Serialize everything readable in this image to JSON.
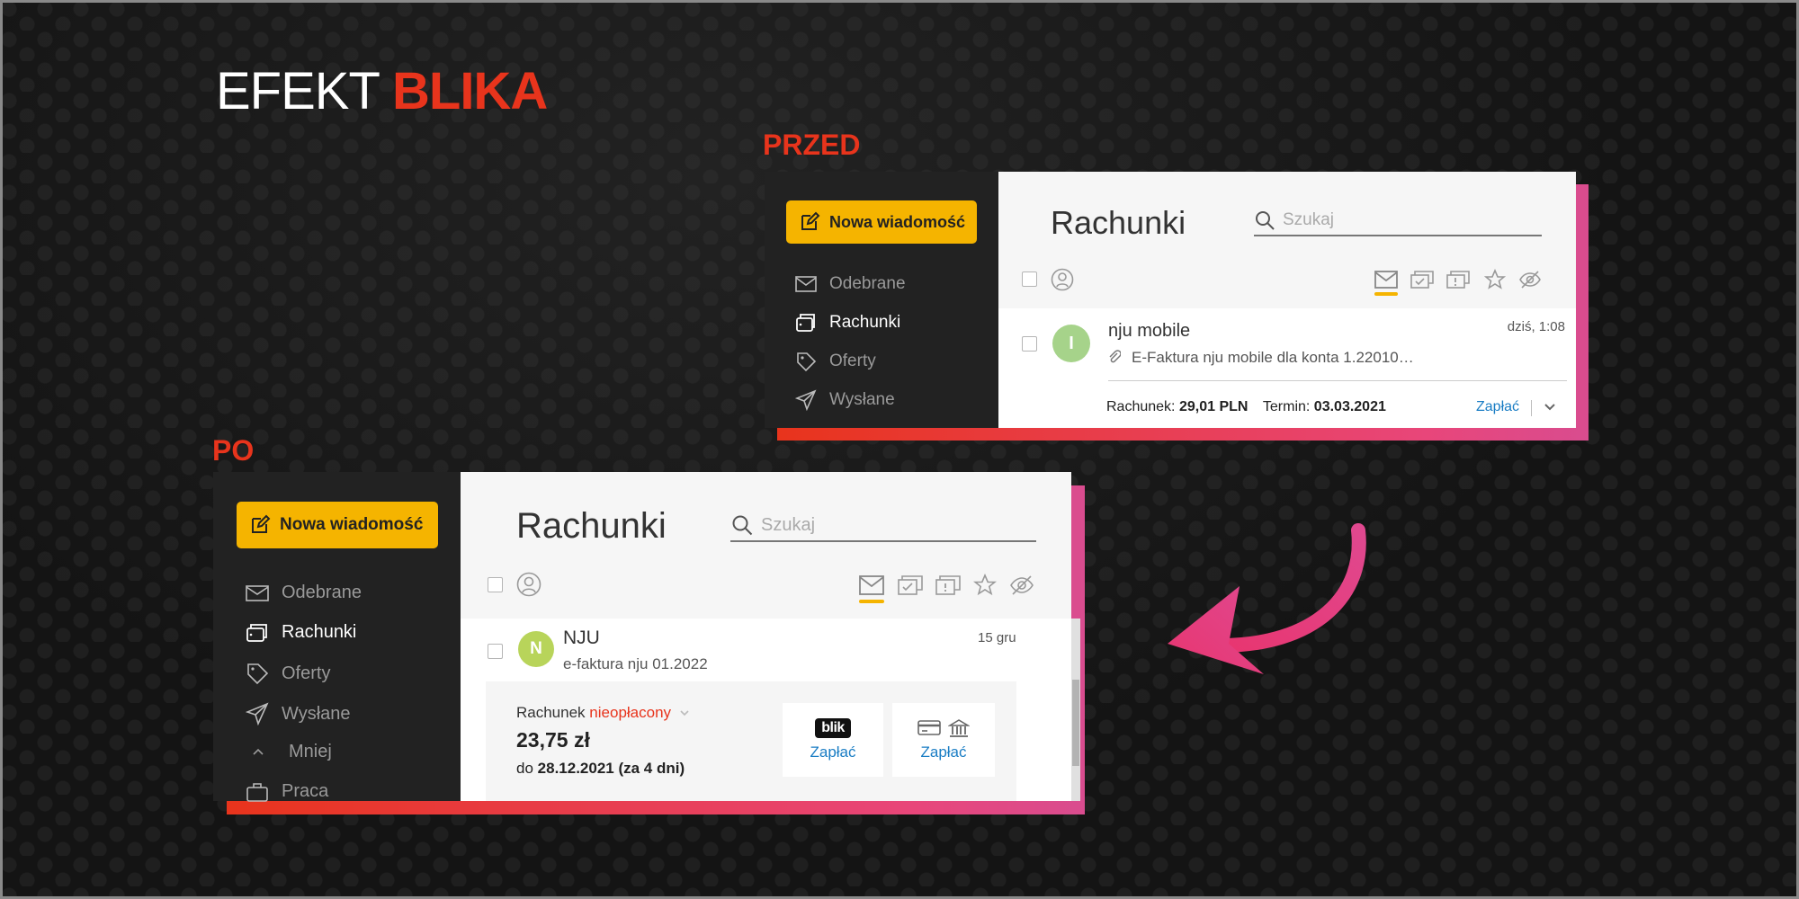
{
  "headline": {
    "light": "EFEKT",
    "bold": "BLIKA"
  },
  "captions": {
    "before": "PRZED",
    "after": "PO"
  },
  "accent_colors": {
    "brand_red": "#e8341c",
    "pink": "#e8467a",
    "compose_yellow": "#f5b400",
    "link_blue": "#1a7dc4"
  },
  "before": {
    "compose_label": "Nowa wiadomość",
    "nav": [
      {
        "label": "Odebrane",
        "icon": "envelope-icon"
      },
      {
        "label": "Rachunki",
        "icon": "bills-icon"
      },
      {
        "label": "Oferty",
        "icon": "tag-icon"
      },
      {
        "label": "Wysłane",
        "icon": "send-icon"
      }
    ],
    "title": "Rachunki",
    "search_placeholder": "Szukaj",
    "toolbar_icons": [
      "envelope-icon",
      "bill-check-icon",
      "bill-alert-icon",
      "star-icon",
      "eye-off-icon"
    ],
    "message": {
      "avatar_letter": "I",
      "sender": "nju mobile",
      "date": "dziś, 1:08",
      "subject": "E-Faktura nju mobile dla konta 1.22010…",
      "bill_label": "Rachunek:",
      "bill_amount": "29,01 PLN",
      "due_label": "Termin:",
      "due_date": "03.03.2021",
      "pay_label": "Zapłać"
    }
  },
  "after": {
    "compose_label": "Nowa wiadomość",
    "nav": [
      {
        "label": "Odebrane",
        "icon": "envelope-icon"
      },
      {
        "label": "Rachunki",
        "icon": "bills-icon"
      },
      {
        "label": "Oferty",
        "icon": "tag-icon"
      },
      {
        "label": "Wysłane",
        "icon": "send-icon"
      },
      {
        "label": "Mniej",
        "icon": "chevron-up-icon"
      },
      {
        "label": "Praca",
        "icon": "briefcase-icon"
      }
    ],
    "title": "Rachunki",
    "search_placeholder": "Szukaj",
    "toolbar_icons": [
      "envelope-icon",
      "bill-check-icon",
      "bill-alert-icon",
      "star-icon",
      "eye-off-icon"
    ],
    "message": {
      "avatar_letter": "N",
      "sender": "NJU",
      "date": "15 gru",
      "subject": "e-faktura nju 01.2022",
      "bill_label": "Rachunek",
      "bill_status": "nieopłacony",
      "amount": "23,75 zł",
      "due_prefix": "do",
      "due_date": "28.12.2021 (za 4 dni)",
      "blik_logo": "blik",
      "pay_blik_label": "Zapłać",
      "pay_transfer_label": "Zapłać"
    }
  }
}
